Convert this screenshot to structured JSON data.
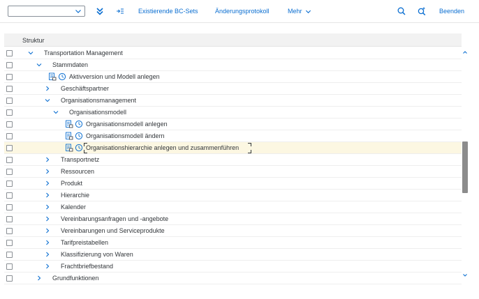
{
  "toolbar": {
    "select_value": "",
    "more_label": "Mehr",
    "items": [
      {
        "label": "Existierende BC-Sets"
      },
      {
        "label": "Änderungsprotokoll"
      }
    ],
    "exit_label": "Beenden"
  },
  "table": {
    "header": "Struktur",
    "rows": [
      {
        "label": "Transportation Management",
        "toggle": "expanded",
        "level": 0,
        "icons": false
      },
      {
        "label": "Stammdaten",
        "toggle": "expanded",
        "level": 1,
        "icons": false
      },
      {
        "label": "Aktivversion und Modell anlegen",
        "toggle": "none",
        "level": 2,
        "icons": true
      },
      {
        "label": "Geschäftspartner",
        "toggle": "collapsed",
        "level": 2,
        "icons": false
      },
      {
        "label": "Organisationsmanagement",
        "toggle": "expanded",
        "level": 2,
        "icons": false
      },
      {
        "label": "Organisationsmodell",
        "toggle": "expanded",
        "level": 3,
        "icons": false
      },
      {
        "label": "Organisationsmodell anlegen",
        "toggle": "none",
        "level": 4,
        "icons": true
      },
      {
        "label": "Organisationsmodell ändern",
        "toggle": "none",
        "level": 4,
        "icons": true
      },
      {
        "label": "Organisationshierarchie anlegen und zusammenführen",
        "toggle": "none",
        "level": 4,
        "icons": true,
        "selected": true
      },
      {
        "label": "Transportnetz",
        "toggle": "collapsed",
        "level": 2,
        "icons": false
      },
      {
        "label": "Ressourcen",
        "toggle": "collapsed",
        "level": 2,
        "icons": false
      },
      {
        "label": "Produkt",
        "toggle": "collapsed",
        "level": 2,
        "icons": false
      },
      {
        "label": "Hierarchie",
        "toggle": "collapsed",
        "level": 2,
        "icons": false
      },
      {
        "label": "Kalender",
        "toggle": "collapsed",
        "level": 2,
        "icons": false
      },
      {
        "label": "Vereinbarungsanfragen und -angebote",
        "toggle": "collapsed",
        "level": 2,
        "icons": false
      },
      {
        "label": "Vereinbarungen und Serviceprodukte",
        "toggle": "collapsed",
        "level": 2,
        "icons": false
      },
      {
        "label": "Tarifpreistabellen",
        "toggle": "collapsed",
        "level": 2,
        "icons": false
      },
      {
        "label": "Klassifizierung von Waren",
        "toggle": "collapsed",
        "level": 2,
        "icons": false
      },
      {
        "label": "Frachtbriefbestand",
        "toggle": "collapsed",
        "level": 2,
        "icons": false
      },
      {
        "label": "Grundfunktionen",
        "toggle": "collapsed",
        "level": 1,
        "icons": false
      }
    ]
  },
  "colors": {
    "accent": "#0a6ed1",
    "selected_row": "#fcf7e2",
    "text": "#32363a"
  }
}
